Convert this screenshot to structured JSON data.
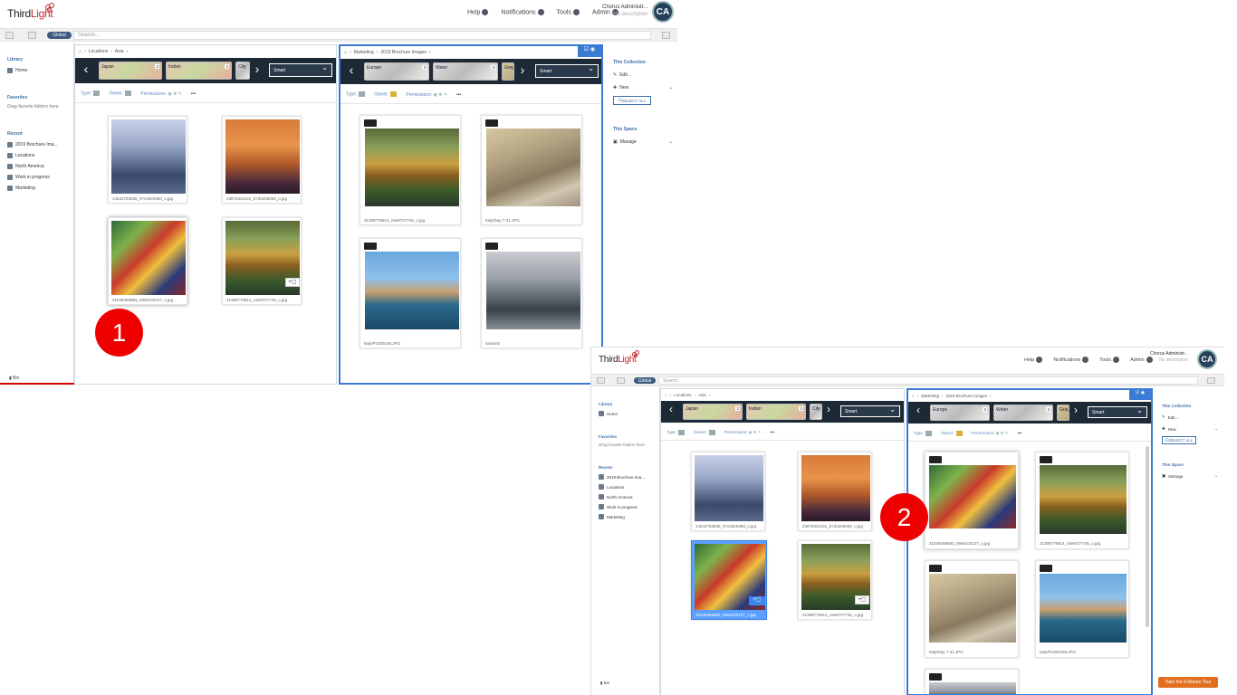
{
  "app": {
    "logo_text_a": "Third",
    "logo_text_b": "Light",
    "nav": {
      "help": "Help",
      "notifications": "Notifications",
      "tools": "Tools",
      "admin": "Admin"
    },
    "user": {
      "name": "Chorus Administr...",
      "description": "No description",
      "initials": "CA"
    },
    "search": {
      "scope": "Global",
      "placeholder": "Search..."
    }
  },
  "sidebar": {
    "library_heading": "Library",
    "home": "Home",
    "favorites_heading": "Favorites",
    "favorites_note": "Drag favorite folders here.",
    "recent_heading": "Recent",
    "recent": [
      "2019 Brochure Ima...",
      "Locations",
      "North America",
      "Work in progress",
      "Marketing"
    ],
    "bin": "Bin"
  },
  "filters": {
    "type": "Type:",
    "owner": "Owner:",
    "permissions": "Permissions:",
    "more": "•••"
  },
  "left_pane": {
    "breadcrumb": [
      "Locations",
      "Asia"
    ],
    "chips": [
      {
        "label": "Japan",
        "count": "2"
      },
      {
        "label": "Indian",
        "count": "2"
      },
      {
        "label": "City",
        "count": ""
      }
    ],
    "sort": "Smart",
    "items": [
      {
        "caption": "14542763536_07c0de938d_o.jpg"
      },
      {
        "caption": "23876331191_b7d4258459_o.jpg"
      },
      {
        "caption": "31049459683_09e0c00127_o.jpg"
      },
      {
        "caption": "31389776814_c5e8727745_o.jpg"
      }
    ]
  },
  "right_pane": {
    "breadcrumb": [
      "Marketing",
      "2019 Brochure Images"
    ],
    "chips": [
      {
        "label": "Europe",
        "count": "3"
      },
      {
        "label": "Water",
        "count": "3"
      },
      {
        "label": "Gray",
        "count": ""
      }
    ],
    "sort": "Smart",
    "items_before": [
      {
        "caption": "31389776814_c5e8727745_o.jpg"
      },
      {
        "caption": "Italy/Day 7-31.JPG"
      },
      {
        "caption": "Italy/P1000168.JPG"
      },
      {
        "caption": "london0"
      }
    ],
    "items_after": [
      {
        "caption": "31049459683_09e0c00127_o.jpg"
      },
      {
        "caption": "31389776814_c5e8727745_o.jpg"
      },
      {
        "caption": "Italy/Day 7-31.JPG"
      },
      {
        "caption": "Italy/P1000168.JPG"
      }
    ]
  },
  "context_panel": {
    "collection_heading": "This Collection",
    "edit": "Edit...",
    "new": "New",
    "select_all": "SELECT ALL",
    "space_heading": "This Space",
    "manage": "Manage"
  },
  "markers": {
    "step1": "1",
    "step2": "2"
  },
  "tour_button": "Take the 5-Minute Tour",
  "colors": {
    "accent": "#3d6ea8",
    "strip": "#1d2a36",
    "marker": "#e00000",
    "selection": "#5aa0ff",
    "brand_red": "#c1272d"
  }
}
